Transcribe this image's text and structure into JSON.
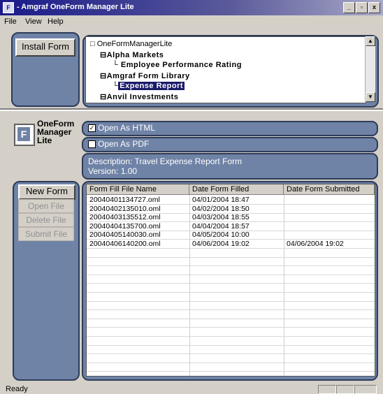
{
  "window": {
    "title": "- Amgraf OneForm Manager Lite",
    "controls": [
      "_",
      "▫",
      "x"
    ]
  },
  "menu": [
    "File",
    "View",
    "Help"
  ],
  "toolbar": {
    "install_label": "Install Form"
  },
  "tree": {
    "root": "OneFormManagerLite",
    "nodes": [
      {
        "label": "Alpha Markets",
        "level": 1,
        "expander": "⊟"
      },
      {
        "label": "Employee Performance Rating",
        "level": 2
      },
      {
        "label": "Amgraf Form Library",
        "level": 1,
        "expander": "⊟"
      },
      {
        "label": "Expense Report",
        "level": 2,
        "selected": true
      },
      {
        "label": "Anvil Investments",
        "level": 1,
        "expander": "⊟"
      }
    ]
  },
  "logo": {
    "text": "OneForm\nManager\nLite",
    "glyph": "F"
  },
  "options": {
    "html": {
      "label": "Open As HTML",
      "checked": true
    },
    "pdf": {
      "label": "Open As PDF",
      "checked": false
    }
  },
  "description": {
    "line1": "Description: Travel Expense Report Form",
    "line2": "Version: 1.00"
  },
  "actions": {
    "new_form": "New Form",
    "open_file": "Open File",
    "delete_file": "Delete File",
    "submit_file": "Submit File"
  },
  "table": {
    "columns": [
      "Form Fill File Name",
      "Date Form Filled",
      "Date Form Submitted"
    ],
    "rows": [
      [
        "20040401134727.oml",
        "04/01/2004 18:47",
        ""
      ],
      [
        "20040402135010.oml",
        "04/02/2004 18:50",
        ""
      ],
      [
        "20040403135512.oml",
        "04/03/2004 18:55",
        ""
      ],
      [
        "20040404135700.oml",
        "04/04/2004 18:57",
        ""
      ],
      [
        "20040405140030.oml",
        "04/05/2004 10:00",
        ""
      ],
      [
        "20040406140200.oml",
        "04/06/2004 19:02",
        "04/06/2004 19:02"
      ]
    ]
  },
  "status": {
    "text": "Ready"
  }
}
